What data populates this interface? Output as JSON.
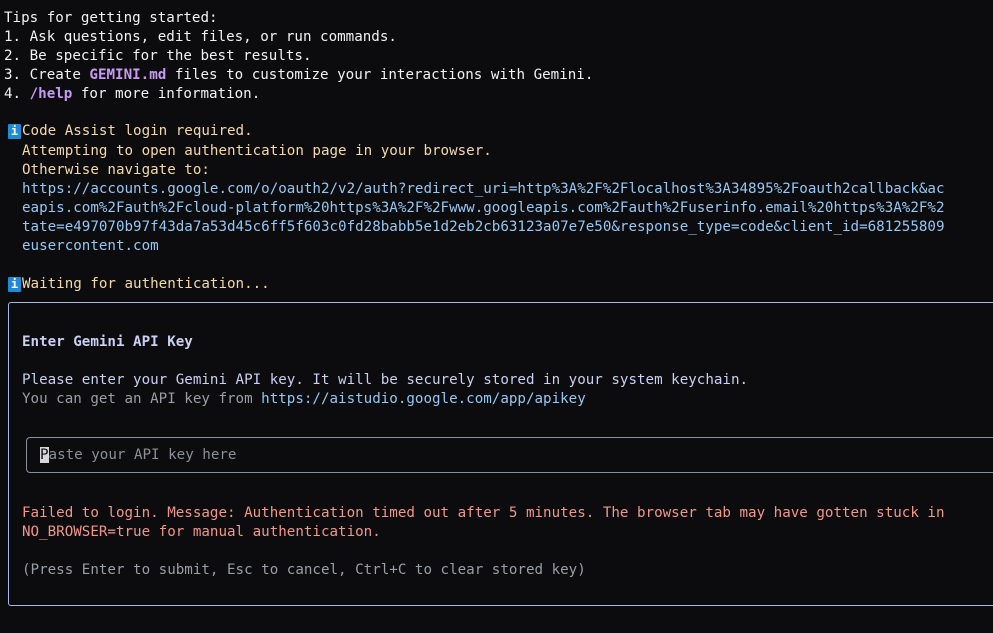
{
  "tips": {
    "heading": "Tips for getting started:",
    "item1": "1. Ask questions, edit files, or run commands.",
    "item2": "2. Be specific for the best results.",
    "item3_prefix": "3. Create ",
    "item3_file": "GEMINI.md",
    "item3_suffix": " files to customize your interactions with Gemini.",
    "item4_prefix": "4. ",
    "item4_cmd": "/help",
    "item4_suffix": " for more information."
  },
  "login": {
    "icon": "i",
    "title": "Code Assist login required.",
    "attempting": "Attempting to open authentication page in your browser.",
    "otherwise": "Otherwise navigate to:",
    "url_line1": "https://accounts.google.com/o/oauth2/v2/auth?redirect_uri=http%3A%2F%2Flocalhost%3A34895%2Foauth2callback&ac",
    "url_line2": "eapis.com%2Fauth%2Fcloud-platform%20https%3A%2F%2Fwww.googleapis.com%2Fauth%2Fuserinfo.email%20https%3A%2F%2",
    "url_line3": "tate=e497070b97f43da7a53d45c6ff5f603c0fd28babb5e1d2eb2cb63123a07e7e50&response_type=code&client_id=681255809",
    "url_line4": "eusercontent.com"
  },
  "waiting": {
    "icon": "i",
    "text": "Waiting for authentication..."
  },
  "dialog": {
    "title": "Enter Gemini API Key",
    "description": "Please enter your Gemini API key. It will be securely stored in your system keychain.",
    "hint_prefix": "You can get an API key from ",
    "hint_url": "https://aistudio.google.com/app/apikey",
    "input": {
      "placeholder_first": "P",
      "placeholder_rest": "aste your API key here",
      "value": ""
    },
    "error_line1": "Failed to login. Message: Authentication timed out after 5 minutes. The browser tab may have gotten stuck in",
    "error_line2": "NO_BROWSER=true for manual authentication.",
    "footer": "(Press Enter to submit, Esc to cancel, Ctrl+C to clear stored key)"
  },
  "colors": {
    "background": "#0c0c0e",
    "accent_purple": "#c79bf2",
    "info_yellow": "#f5d9a4",
    "link_blue": "#94c7f2",
    "error_red": "#f2968a",
    "dialog_border": "#a8b8e8",
    "info_badge": "#1f8bd6"
  }
}
